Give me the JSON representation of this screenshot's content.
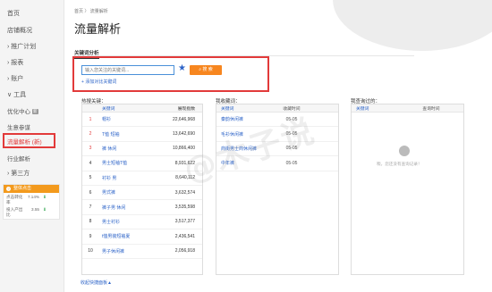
{
  "sidebar": {
    "items": [
      {
        "label": "首页"
      },
      {
        "label": "店铺概况"
      },
      {
        "label": "› 推广计划"
      },
      {
        "label": "› 报表"
      },
      {
        "label": "› 账户"
      },
      {
        "label": "∨ 工具"
      },
      {
        "label": "优化中心",
        "badge": "新"
      },
      {
        "label": "生意参谋"
      },
      {
        "label": "流量解析 (新)"
      },
      {
        "label": "行业解析"
      },
      {
        "label": "› 第三方"
      }
    ],
    "stats": {
      "title": "整体点击",
      "rows": [
        {
          "k": "点击转化率",
          "v": "7.14%"
        },
        {
          "k": "投入产出比",
          "v": "3.55"
        }
      ]
    }
  },
  "breadcrumb": "首页  〉 流量解析",
  "page_title": "流量解析",
  "tab": "关键词分析",
  "search": {
    "placeholder": "输入您关注的关键词...",
    "button": "搜 索",
    "add_link": "添加对比关键词"
  },
  "hot_words": {
    "label": "热搜关键：",
    "col_keyword": "关键词",
    "col_value": "展现指数",
    "rows": [
      {
        "rank": "1",
        "kw": "帽衫",
        "val": "22,646,968"
      },
      {
        "rank": "2",
        "kw": "T恤 短袖",
        "val": "13,642,690"
      },
      {
        "rank": "3",
        "kw": "裤 休闲",
        "val": "10,866,400"
      },
      {
        "rank": "4",
        "kw": "男士短袖T恤",
        "val": "8,931,622"
      },
      {
        "rank": "5",
        "kw": "衬衫 男",
        "val": "8,640,112"
      },
      {
        "rank": "6",
        "kw": "男式裤",
        "val": "3,632,574"
      },
      {
        "rank": "7",
        "kw": "裤子男 休闲",
        "val": "3,535,598"
      },
      {
        "rank": "8",
        "kw": "男士衬衫",
        "val": "3,517,377"
      },
      {
        "rank": "9",
        "kw": "t恤男装短袖夏",
        "val": "2,436,541"
      },
      {
        "rank": "10",
        "kw": "男子休闲裤",
        "val": "2,056,918"
      }
    ]
  },
  "recent": {
    "label": "我收藏词：",
    "col_keyword": "关键词",
    "col_time": "收藏时间",
    "rows": [
      {
        "kw": "秦韵休闲裤",
        "time": "05-05"
      },
      {
        "kw": "毛衫休闲裤",
        "time": "05-05"
      },
      {
        "kw": "商街男士商休闲裤",
        "time": "05-05"
      },
      {
        "kw": "中年裤",
        "time": "05-05"
      }
    ]
  },
  "history": {
    "label": "我查询过的：",
    "col_keyword": "关键词",
    "col_time": "查询时间",
    "empty_text": "噢，您还没有查询记录！"
  },
  "collapse_link": "收起快捷面板▲",
  "watermark": "@木子说"
}
